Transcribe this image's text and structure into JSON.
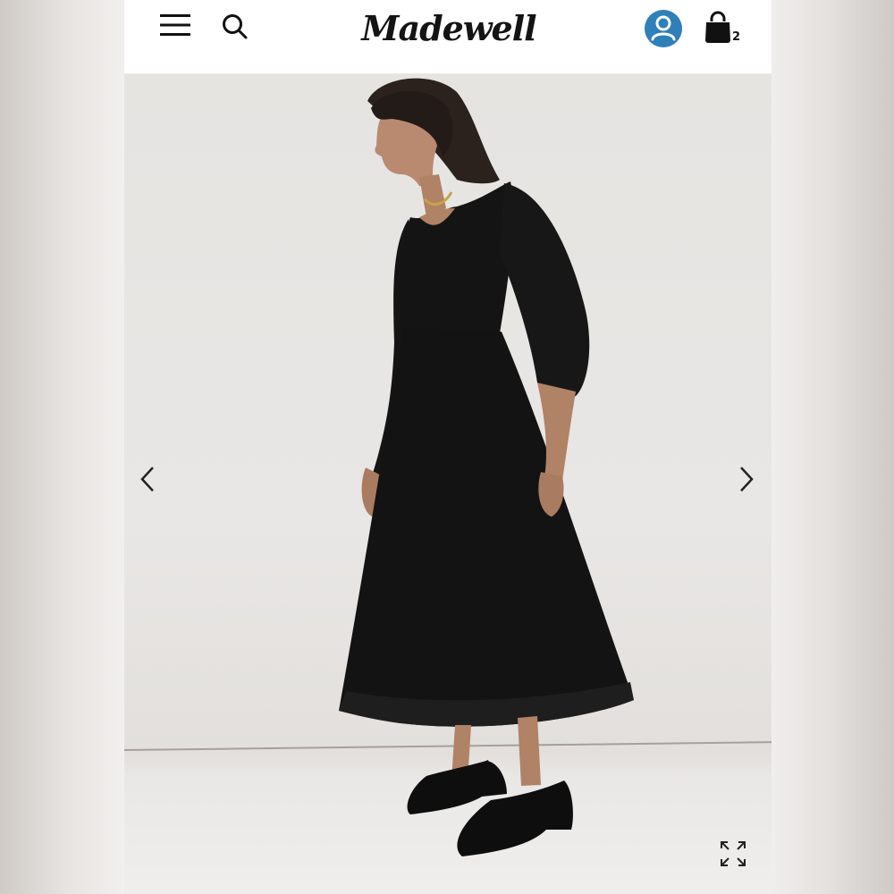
{
  "header": {
    "brand": "Madewell",
    "bag_count": "2"
  },
  "icons": {
    "menu": "hamburger-menu-icon",
    "search": "search-icon",
    "account": "user-account-icon",
    "bag": "shopping-bag-icon",
    "prev": "chevron-left-icon",
    "next": "chevron-right-icon",
    "expand": "expand-fullscreen-icon"
  },
  "colors": {
    "account_accent": "#2f7fb8",
    "header_bg": "#ffffff",
    "dress": "#141414"
  }
}
